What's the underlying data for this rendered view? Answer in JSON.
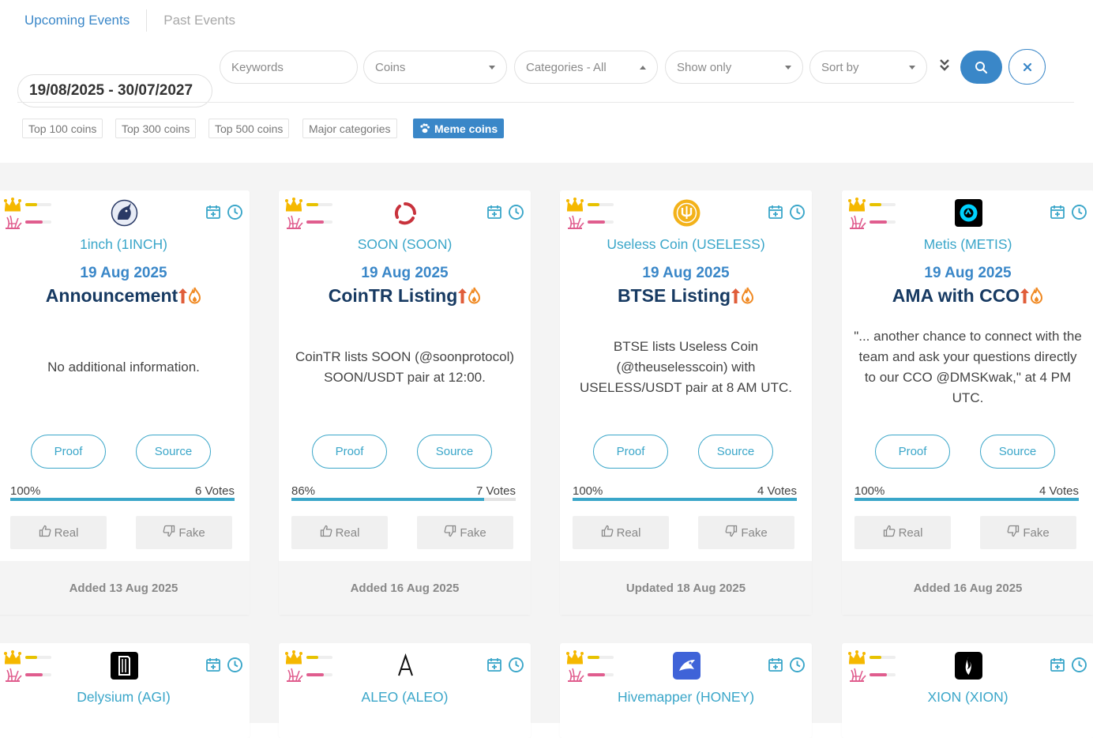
{
  "tabs": {
    "upcoming": "Upcoming Events",
    "past": "Past Events"
  },
  "filters": {
    "date_range": "19/08/2025 - 30/07/2027",
    "keywords_placeholder": "Keywords",
    "coins": "Coins",
    "categories": "Categories - All",
    "show_only": "Show only",
    "sort_by": "Sort by"
  },
  "chips": [
    "Top 100 coins",
    "Top 300 coins",
    "Top 500 coins",
    "Major categories",
    "Meme coins"
  ],
  "colors": {
    "accent": "#3a87c8",
    "teal": "#3aa6c9",
    "navy": "#173a62",
    "hot": "#e05d3a"
  },
  "events": [
    {
      "coin": "1inch (1INCH)",
      "date": "19 Aug 2025",
      "title": "Announcement",
      "desc": "No additional information.",
      "percent": "100%",
      "percent_value": 100,
      "votes": "6 Votes",
      "footer": "Added 13 Aug 2025",
      "logo": "unicorn-logo"
    },
    {
      "coin": "SOON (SOON)",
      "date": "19 Aug 2025",
      "title": "CoinTR Listing",
      "desc": "CoinTR lists SOON (@soonprotocol) SOON/USDT pair at 12:00.",
      "percent": "86%",
      "percent_value": 86,
      "votes": "7 Votes",
      "footer": "Added 16 Aug 2025",
      "logo": "soon-ring-logo"
    },
    {
      "coin": "Useless Coin (USELESS)",
      "date": "19 Aug 2025",
      "title": "BTSE Listing",
      "desc": "BTSE lists Useless Coin (@theuselesscoin) with USELESS/USDT pair at 8 AM UTC.",
      "percent": "100%",
      "percent_value": 100,
      "votes": "4 Votes",
      "footer": "Updated 18 Aug 2025",
      "logo": "useless-gold-logo"
    },
    {
      "coin": "Metis (METIS)",
      "date": "19 Aug 2025",
      "title": "AMA with CCO",
      "desc": "\"... another chance to connect with the team and ask your questions directly to our CCO @DMSKwak,\" at 4 PM UTC.",
      "percent": "100%",
      "percent_value": 100,
      "votes": "4 Votes",
      "footer": "Added 16 Aug 2025",
      "logo": "metis-logo"
    }
  ],
  "events_row2": [
    {
      "coin": "Delysium (AGI)",
      "logo": "delysium-logo"
    },
    {
      "coin": "ALEO (ALEO)",
      "logo": "aleo-logo"
    },
    {
      "coin": "Hivemapper (HONEY)",
      "logo": "hivemapper-logo"
    },
    {
      "coin": "XION (XION)",
      "logo": "xion-logo"
    }
  ],
  "buttons": {
    "proof": "Proof",
    "source": "Source",
    "real": "Real",
    "fake": "Fake"
  }
}
